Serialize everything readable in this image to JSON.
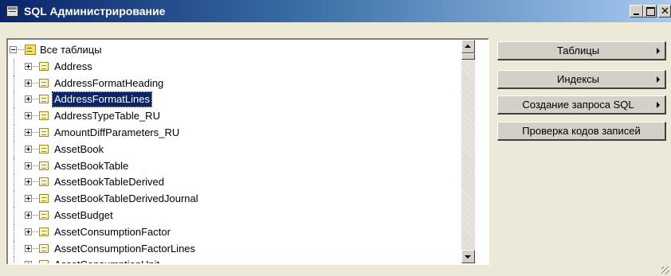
{
  "window": {
    "title": "SQL Администрирование"
  },
  "tree": {
    "root_label": "Все таблицы",
    "items": [
      {
        "label": "Address"
      },
      {
        "label": "AddressFormatHeading"
      },
      {
        "label": "AddressFormatLines",
        "selected": true
      },
      {
        "label": "AddressTypeTable_RU"
      },
      {
        "label": "AmountDiffParameters_RU"
      },
      {
        "label": "AssetBook"
      },
      {
        "label": "AssetBookTable"
      },
      {
        "label": "AssetBookTableDerived"
      },
      {
        "label": "AssetBookTableDerivedJournal"
      },
      {
        "label": "AssetBudget"
      },
      {
        "label": "AssetConsumptionFactor"
      },
      {
        "label": "AssetConsumptionFactorLines"
      },
      {
        "label": "AssetConsumptionUnit"
      }
    ]
  },
  "side_buttons": {
    "tables": "Таблицы",
    "indexes": "Индексы",
    "sql_query": "Создание запроса SQL",
    "check_codes": "Проверка кодов записей"
  }
}
